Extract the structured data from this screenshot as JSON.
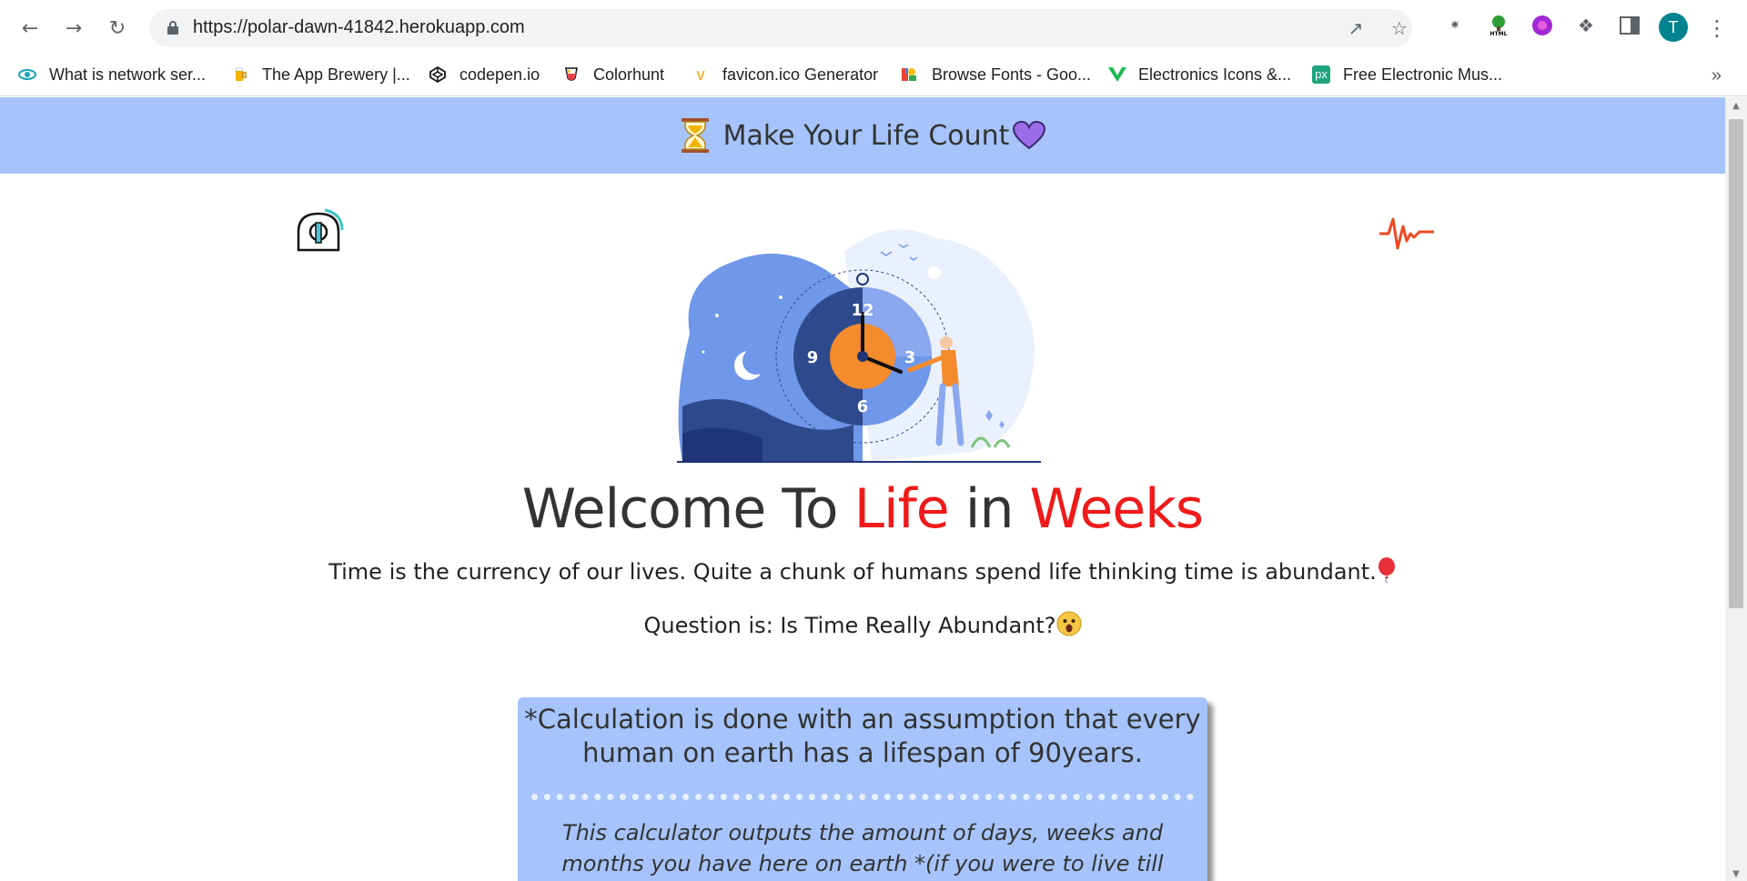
{
  "browser": {
    "url": "https://polar-dawn-41842.herokuapp.com",
    "avatar_initial": "T",
    "bookmarks": [
      {
        "label": "What is network ser...",
        "icon": "eye-icon"
      },
      {
        "label": "The App Brewery |...",
        "icon": "beer-icon"
      },
      {
        "label": "codepen.io",
        "icon": "codepen-icon"
      },
      {
        "label": "Colorhunt",
        "icon": "colorhunt-icon"
      },
      {
        "label": "favicon.ico Generator",
        "icon": "favicon-generator-icon"
      },
      {
        "label": "Browse Fonts - Goo...",
        "icon": "google-fonts-icon"
      },
      {
        "label": "Electronics Icons &...",
        "icon": "electronics-icons-icon"
      },
      {
        "label": "Free Electronic Mus...",
        "icon": "px-icon"
      }
    ],
    "more_bookmarks": "»"
  },
  "banner": {
    "title": "Make Your Life Count",
    "color": "#a6c4fb"
  },
  "main": {
    "heading_part1": "Welcome To ",
    "heading_life": "Life",
    "heading_in": " in ",
    "heading_weeks": "Weeks",
    "accent_color": "#f01a1a",
    "tagline": "Time is the currency of our lives. Quite a chunk of humans spend life thinking time is abundant.",
    "question": "Question is: Is Time Really Abundant?",
    "clock_numbers": [
      "12",
      "3",
      "6",
      "9"
    ]
  },
  "card": {
    "heading": "*Calculation is done with an assumption that every human on earth has a lifespan of 90years.",
    "body": "This calculator outputs the amount of days, weeks and months you have here on earth *(if you were to live till"
  }
}
